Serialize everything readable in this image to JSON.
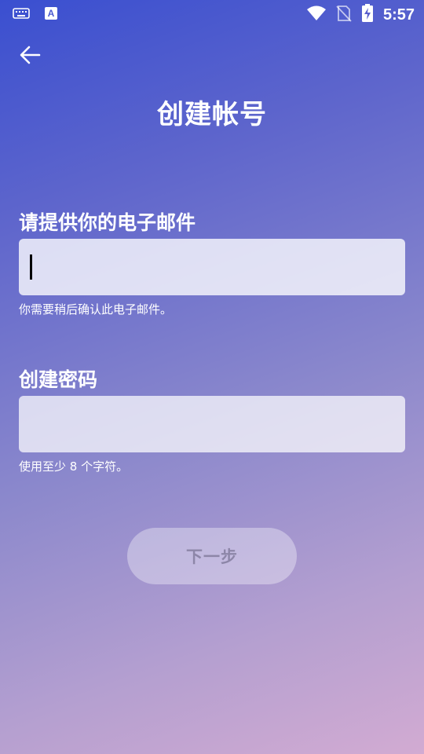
{
  "status_bar": {
    "time": "5:57",
    "icons": [
      "keyboard-icon",
      "font-a-icon",
      "wifi-icon",
      "no-sim-icon",
      "battery-charging-icon"
    ]
  },
  "header": {
    "back_icon": "arrow-left-icon",
    "title": "创建帐号"
  },
  "email": {
    "label": "请提供你的电子邮件",
    "value": "",
    "hint": "你需要稍后确认此电子邮件。"
  },
  "password": {
    "label": "创建密码",
    "value": "",
    "hint": "使用至少 8 个字符。"
  },
  "actions": {
    "next_label": "下一步"
  },
  "colors": {
    "gradient_top": "#3a4fd0",
    "gradient_bottom": "#d2abd2",
    "button_text_disabled": "#8d86a8"
  }
}
